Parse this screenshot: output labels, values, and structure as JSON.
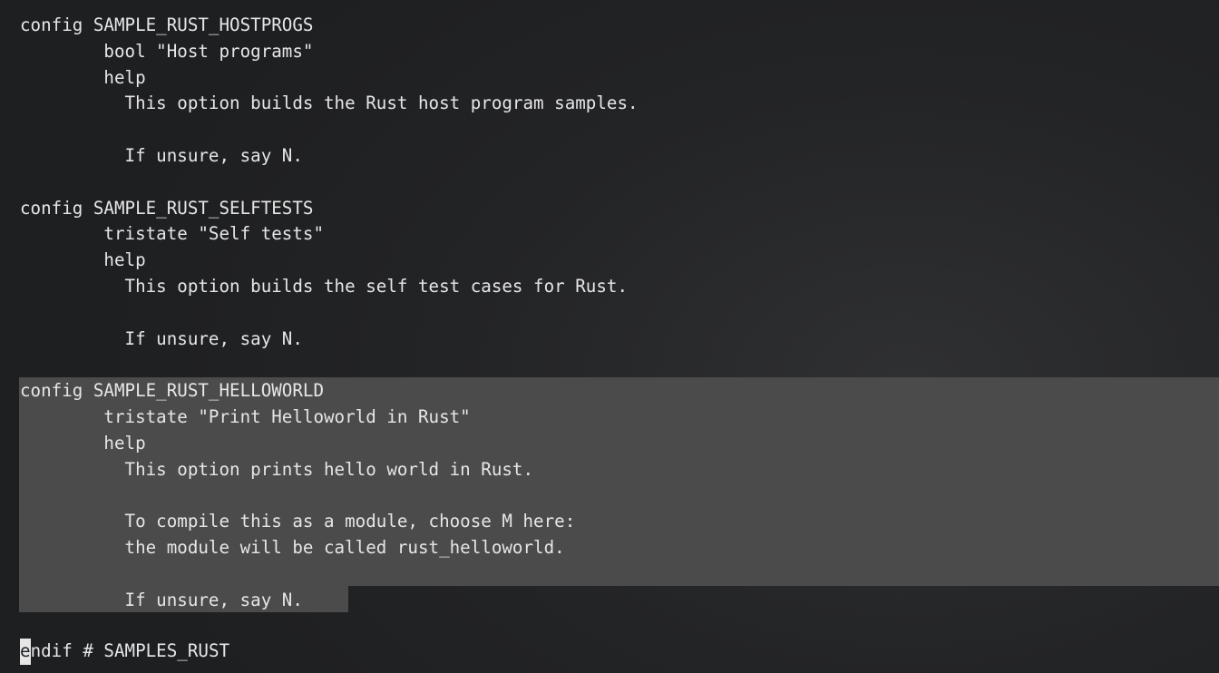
{
  "terminal": {
    "lines": [
      "config SAMPLE_RUST_HOSTPROGS",
      "        bool \"Host programs\"",
      "        help",
      "          This option builds the Rust host program samples.",
      "",
      "          If unsure, say N.",
      "",
      "config SAMPLE_RUST_SELFTESTS",
      "        tristate \"Self tests\"",
      "        help",
      "          This option builds the self test cases for Rust.",
      "",
      "          If unsure, say N.",
      "",
      "config SAMPLE_RUST_HELLOWORLD",
      "        tristate \"Print Helloworld in Rust\"",
      "        help",
      "          This option prints hello world in Rust.",
      "",
      "          To compile this as a module, choose M here:",
      "          the module will be called rust_helloworld.",
      "",
      "          If unsure, say N.",
      "",
      "ndif # SAMPLES_RUST"
    ],
    "cursor_char": "e",
    "selection": {
      "first_line_index": 14,
      "last_full_line_index": 21,
      "partial_line_index": 22
    }
  }
}
